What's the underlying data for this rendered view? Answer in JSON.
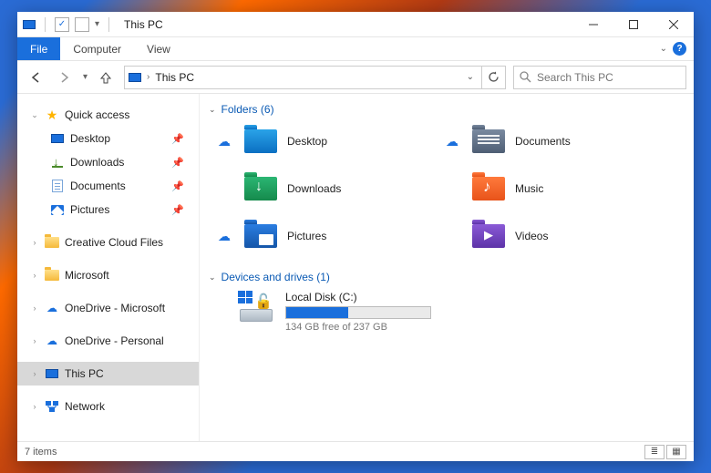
{
  "titlebar": {
    "title": "This PC"
  },
  "ribbon": {
    "file": "File",
    "tabs": [
      "Computer",
      "View"
    ]
  },
  "nav": {
    "crumb": "This PC",
    "search_placeholder": "Search This PC"
  },
  "sidebar": {
    "quick_access": "Quick access",
    "items": [
      {
        "label": "Desktop"
      },
      {
        "label": "Downloads"
      },
      {
        "label": "Documents"
      },
      {
        "label": "Pictures"
      }
    ],
    "others": [
      {
        "label": "Creative Cloud Files"
      },
      {
        "label": "Microsoft"
      },
      {
        "label": "OneDrive - Microsoft"
      },
      {
        "label": "OneDrive - Personal"
      },
      {
        "label": "This PC"
      },
      {
        "label": "Network"
      }
    ]
  },
  "content": {
    "folders_header": "Folders (6)",
    "folders": [
      {
        "label": "Desktop",
        "cloud": true
      },
      {
        "label": "Documents",
        "cloud": true
      },
      {
        "label": "Downloads",
        "cloud": false
      },
      {
        "label": "Music",
        "cloud": false
      },
      {
        "label": "Pictures",
        "cloud": true
      },
      {
        "label": "Videos",
        "cloud": false
      }
    ],
    "drives_header": "Devices and drives (1)",
    "drive": {
      "name": "Local Disk (C:)",
      "free_text": "134 GB free of 237 GB",
      "used_pct": 43
    }
  },
  "status": {
    "items": "7 items"
  }
}
